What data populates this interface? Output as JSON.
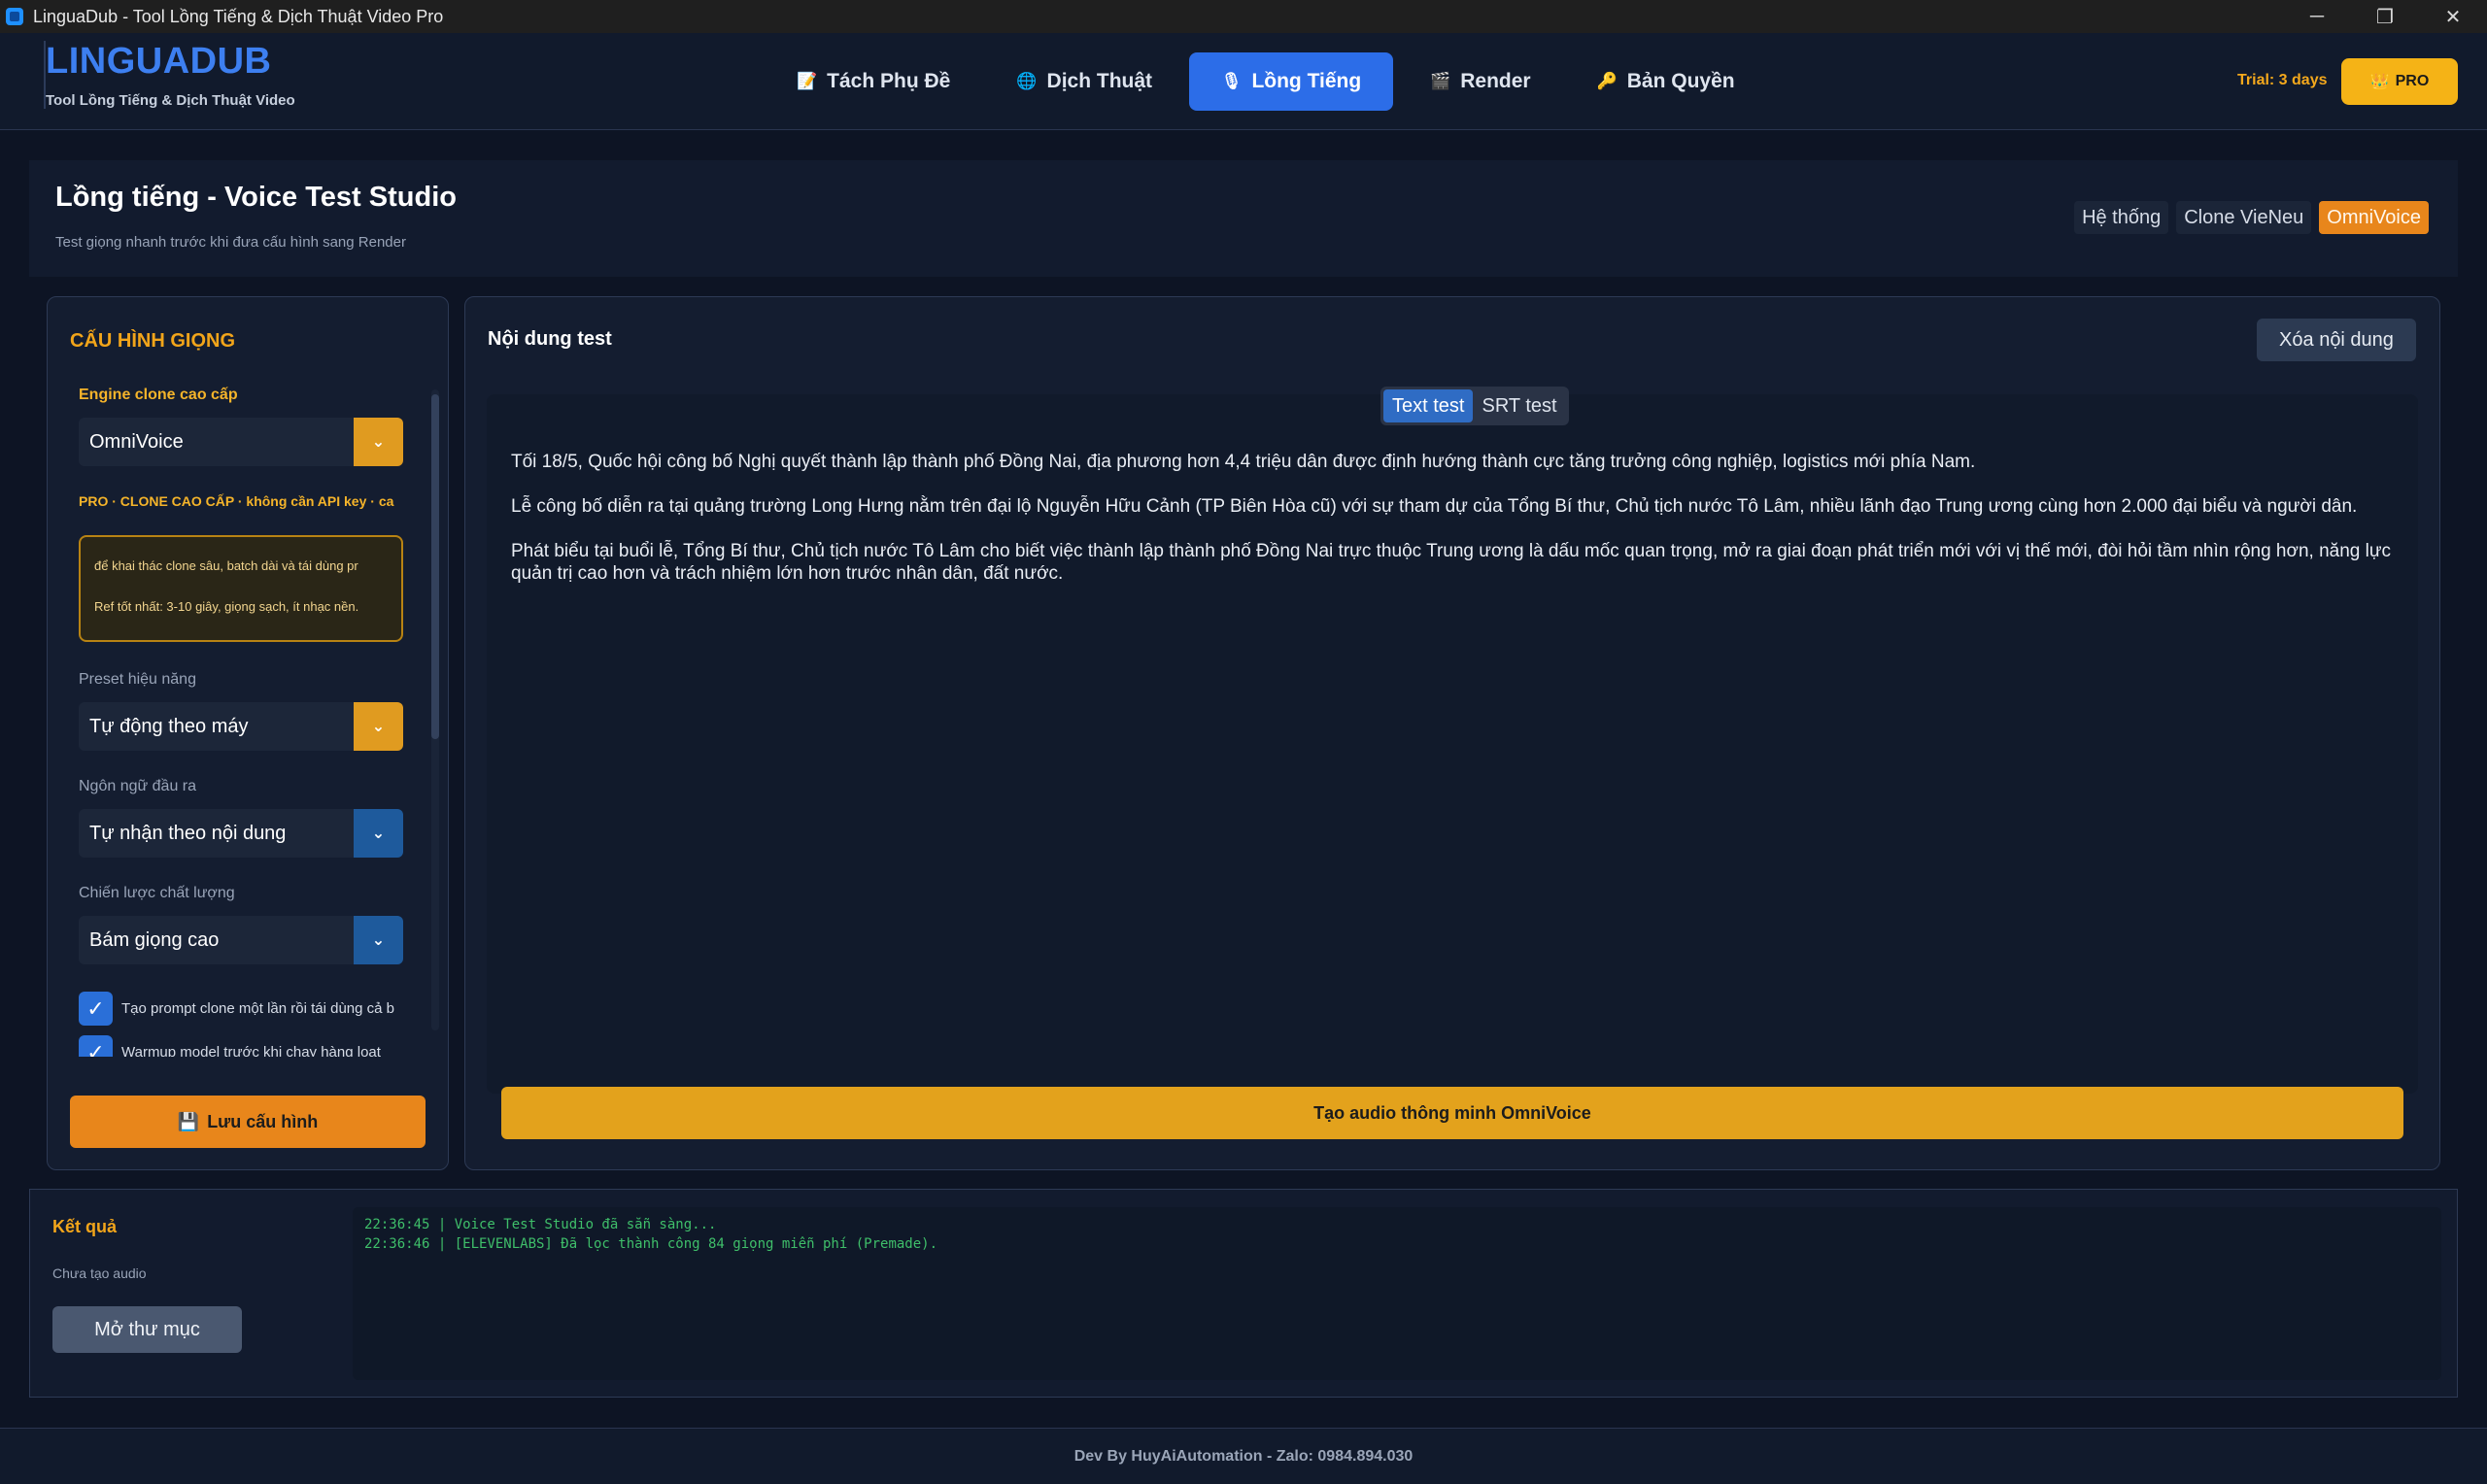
{
  "window": {
    "title": "LinguaDub - Tool Lồng Tiếng & Dịch Thuật Video Pro",
    "controls": {
      "minimize": "─",
      "restore": "❐",
      "close": "✕"
    }
  },
  "brand": {
    "name": "LINGUADUB",
    "subtitle": "Tool Lồng Tiếng & Dịch Thuật Video"
  },
  "nav": {
    "items": [
      {
        "label": "Tách Phụ Đề",
        "icon": "📝"
      },
      {
        "label": "Dịch Thuật",
        "icon": "🌐"
      },
      {
        "label": "Lồng Tiếng",
        "icon": "🎙"
      },
      {
        "label": "Render",
        "icon": "🎬"
      },
      {
        "label": "Bản Quyền",
        "icon": "🔑"
      }
    ],
    "active": "Lồng Tiếng"
  },
  "trial": "Trial: 3 days",
  "pro_button": {
    "label": "PRO",
    "icon": "👑"
  },
  "studio": {
    "title": "Lồng tiếng - Voice Test Studio",
    "subtitle": "Test giọng nhanh trước khi đưa cấu hình sang Render",
    "engines": [
      "Hệ thống",
      "Clone VieNeu",
      "OmniVoice"
    ],
    "active_engine": "OmniVoice"
  },
  "config": {
    "title": "CẤU HÌNH GIỌNG",
    "engine_label": "Engine clone cao cấp",
    "engine_value": "OmniVoice",
    "pro_note": "PRO · CLONE CAO CẤP · không cần API key · ca",
    "info_lines": [
      "để khai thác clone sâu, batch dài và tái dùng pr",
      "Ref tốt nhất: 3-10 giây, giọng sạch, ít nhạc nền."
    ],
    "preset_label": "Preset hiệu năng",
    "preset_value": "Tự động theo máy",
    "lang_label": "Ngôn ngữ đầu ra",
    "lang_value": "Tự nhận theo nội dung",
    "quality_label": "Chiến lược chất lượng",
    "quality_value": "Bám giọng cao",
    "checkboxes": [
      {
        "label": "Tạo prompt clone một lần rồi tái dùng cả b",
        "checked": true
      },
      {
        "label": "Warmup model trước khi chạy hàng loạt",
        "checked": true
      }
    ],
    "save_label": "Lưu cấu hình",
    "save_icon": "💾"
  },
  "content": {
    "title": "Nội dung test",
    "clear_label": "Xóa nội dung",
    "tabs": [
      "Text test",
      "SRT test"
    ],
    "active_tab": "Text test",
    "paragraphs": [
      "Tối 18/5, Quốc hội công bố Nghị quyết thành lập thành phố Đồng Nai, địa phương hơn 4,4 triệu dân được định hướng thành cực tăng trưởng công nghiệp, logistics mới phía Nam.",
      "Lễ công bố diễn ra tại quảng trường Long Hưng nằm trên đại lộ Nguyễn Hữu Cảnh (TP Biên Hòa cũ) với sự tham dự của Tổng Bí thư, Chủ tịch nước Tô Lâm, nhiều lãnh đạo Trung ương cùng hơn 2.000 đại biểu và người dân.",
      "Phát biểu tại buổi lễ, Tổng Bí thư, Chủ tịch nước Tô Lâm cho biết việc thành lập thành phố Đồng Nai trực thuộc Trung ương là dấu mốc quan trọng, mở ra giai đoạn phát triển mới với vị thế mới, đòi hỏi tầm nhìn rộng hơn, năng lực quản trị cao hơn và trách nhiệm lớn hơn trước nhân dân, đất nước."
    ],
    "generate_label": "Tạo audio thông minh OmniVoice"
  },
  "result": {
    "title": "Kết quả",
    "status": "Chưa tạo audio",
    "open_folder": "Mở thư mục",
    "log": [
      "22:36:45 | Voice Test Studio đã sẵn sàng...",
      "22:36:46 | [ELEVENLABS] Đã lọc thành công 84 giọng miễn phí (Premade)."
    ]
  },
  "footer": "Dev By HuyAiAutomation - Zalo: 0984.894.030",
  "colors": {
    "accent_blue": "#2c6de8",
    "accent_orange": "#e8861b",
    "gold": "#f5b316",
    "log_green": "#3fbf6a"
  }
}
